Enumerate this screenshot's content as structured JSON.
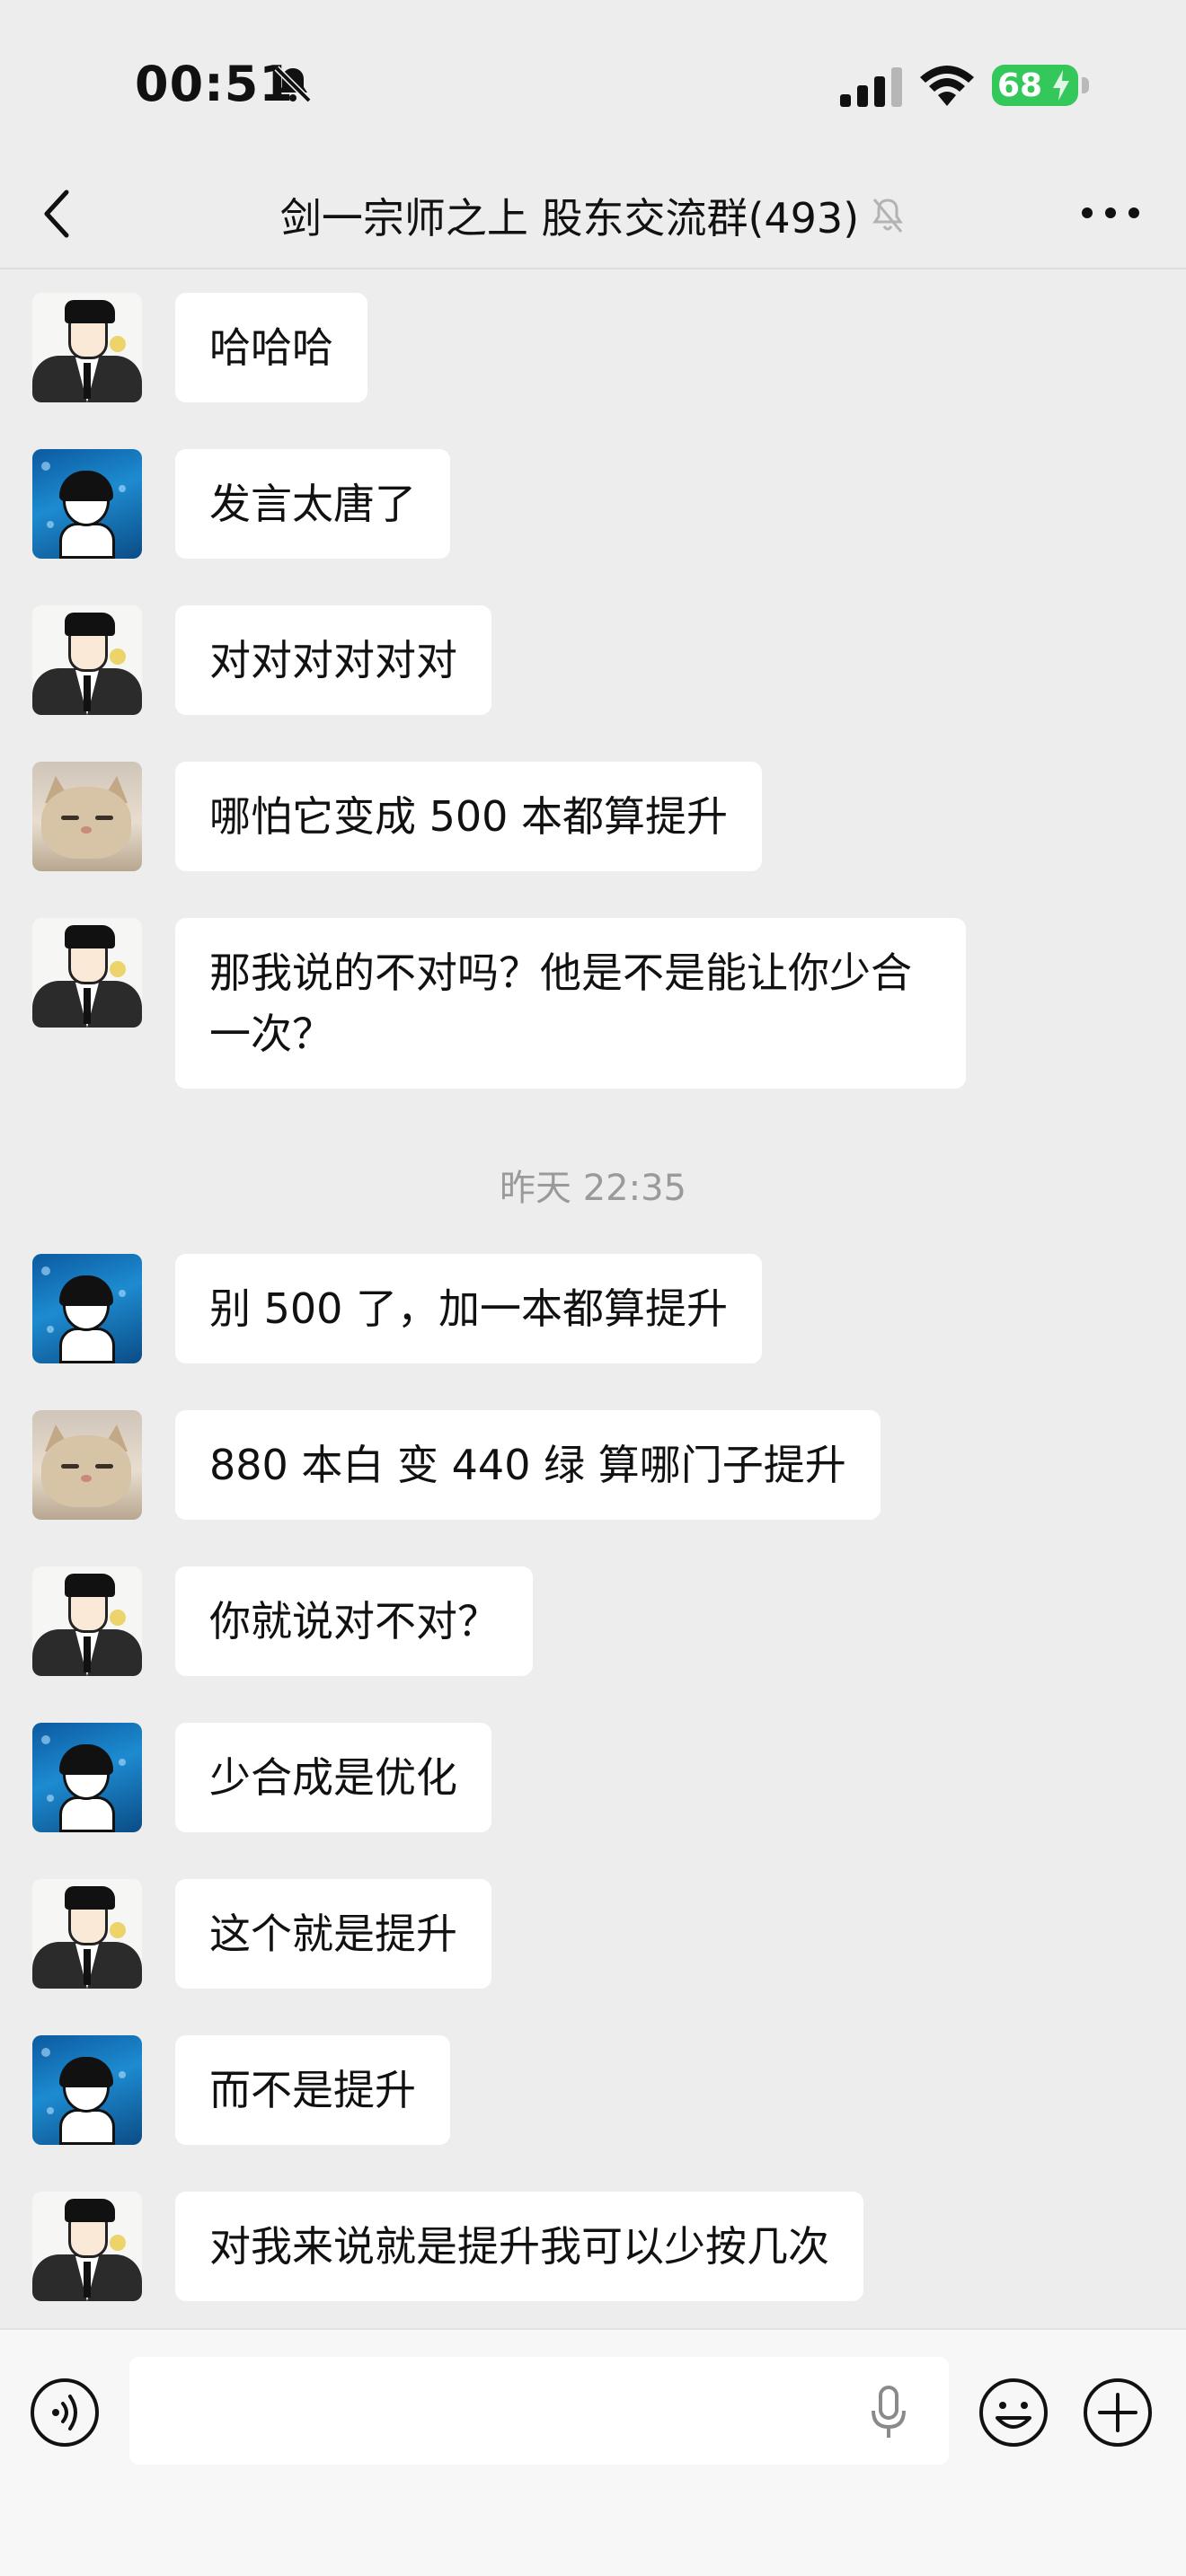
{
  "status_bar": {
    "time": "00:51",
    "battery": "68",
    "accent_green": "#34c759"
  },
  "header": {
    "title": "剑一宗师之上 股东交流群(493)",
    "back_icon": "chevron-left-icon",
    "mute_icon": "bell-slash-icon",
    "more_icon": "ellipsis-icon"
  },
  "messages": [
    {
      "avatar": "man-in-suit",
      "text": "哈哈哈"
    },
    {
      "avatar": "aquarium-boy",
      "text": "发言太唐了"
    },
    {
      "avatar": "man-in-suit",
      "text": "对对对对对对"
    },
    {
      "avatar": "cat",
      "text": "哪怕它变成 500 本都算提升"
    },
    {
      "avatar": "man-in-suit",
      "text": "那我说的不对吗？他是不是能让你少合一次？"
    },
    {
      "avatar": "aquarium-boy",
      "text": "别 500 了，加一本都算提升"
    },
    {
      "avatar": "cat",
      "text": "880 本白 变 440 绿 算哪门子提升"
    },
    {
      "avatar": "man-in-suit",
      "text": "你就说对不对？"
    },
    {
      "avatar": "aquarium-boy",
      "text": "少合成是优化"
    },
    {
      "avatar": "man-in-suit",
      "text": "这个就是提升"
    },
    {
      "avatar": "aquarium-boy",
      "text": "而不是提升"
    },
    {
      "avatar": "man-in-suit",
      "text": "对我来说就是提升我可以少按几次"
    }
  ],
  "timestamp": "昨天 22:35",
  "input_bar": {
    "placeholder": "",
    "voice_icon": "voice-input-icon",
    "mic_icon": "microphone-icon",
    "emoji_icon": "emoji-icon",
    "plus_icon": "plus-circle-icon"
  }
}
